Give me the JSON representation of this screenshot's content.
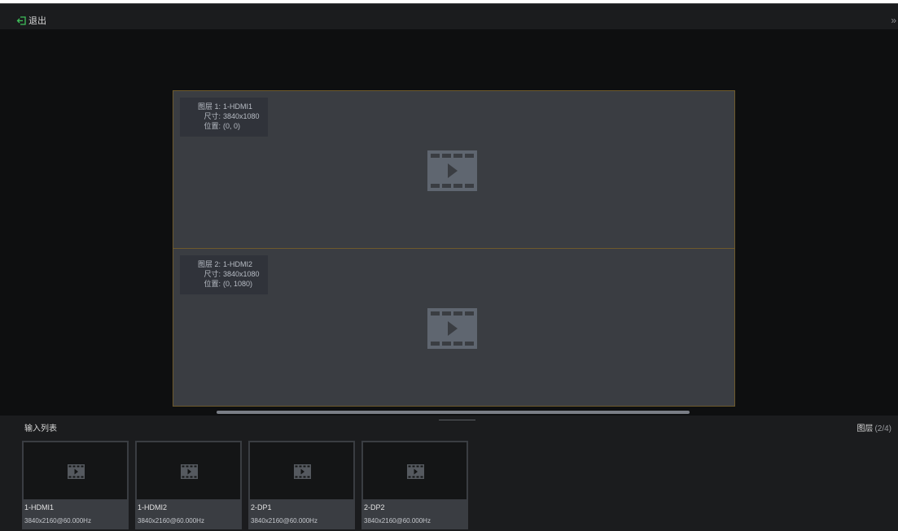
{
  "titlebar": {
    "exit_label": "退出",
    "collapse_glyph": "»"
  },
  "layers": [
    {
      "key_layer": "图层 1:",
      "value_layer": "1-HDMI1",
      "key_size": "尺寸:",
      "value_size": "3840x1080",
      "key_pos": "位置:",
      "value_pos": "(0, 0)",
      "icon": "video-film-icon"
    },
    {
      "key_layer": "图层 2:",
      "value_layer": "1-HDMI2",
      "key_size": "尺寸:",
      "value_size": "3840x1080",
      "key_pos": "位置:",
      "value_pos": "(0, 1080)",
      "icon": "video-film-icon"
    }
  ],
  "bottom": {
    "input_list_title": "输入列表",
    "layer_label": "图层",
    "layer_count": "(2/4)"
  },
  "inputs": [
    {
      "name": "1-HDMI1",
      "resolution": "3840x2160@60.000Hz",
      "icon": "video-film-icon"
    },
    {
      "name": "1-HDMI2",
      "resolution": "3840x2160@60.000Hz",
      "icon": "video-film-icon"
    },
    {
      "name": "2-DP1",
      "resolution": "3840x2160@60.000Hz",
      "icon": "video-film-icon"
    },
    {
      "name": "2-DP2",
      "resolution": "3840x2160@60.000Hz",
      "icon": "video-film-icon"
    }
  ],
  "colors": {
    "accent_green": "#3fbf5a",
    "screen_border": "#6e5a2c",
    "background": "#0e0f10"
  }
}
